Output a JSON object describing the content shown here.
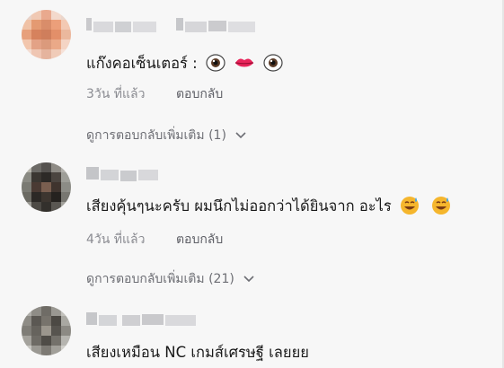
{
  "comments": [
    {
      "text": "แก๊งคอเซ็นเตอร์ :",
      "emojis": [
        "eye-emoji",
        "lips-emoji",
        "eye-emoji"
      ],
      "time": "3วัน ที่แล้ว",
      "reply_label": "ตอบกลับ",
      "more_replies": "ดูการตอบกลับเพิ่มเติม (1)"
    },
    {
      "text": "เสียงคุ้นๆนะครับ ผมนึกไม่ออกว่าได้ยินจาก อะไร",
      "emojis": [
        "sweat-smile-emoji",
        "sweat-smile-emoji"
      ],
      "time": "4วัน ที่แล้ว",
      "reply_label": "ตอบกลับ",
      "more_replies": "ดูการตอบกลับเพิ่มเติม (21)"
    },
    {
      "text": "เสียงเหมือน NC เกมส์เศรษฐี เลยยย"
    }
  ],
  "colors": {
    "background": "#f7f7f7",
    "text": "#1a1a1a",
    "meta": "#8a8b91",
    "lips": "#e8245a",
    "emoji_face": "#f5b62d"
  }
}
